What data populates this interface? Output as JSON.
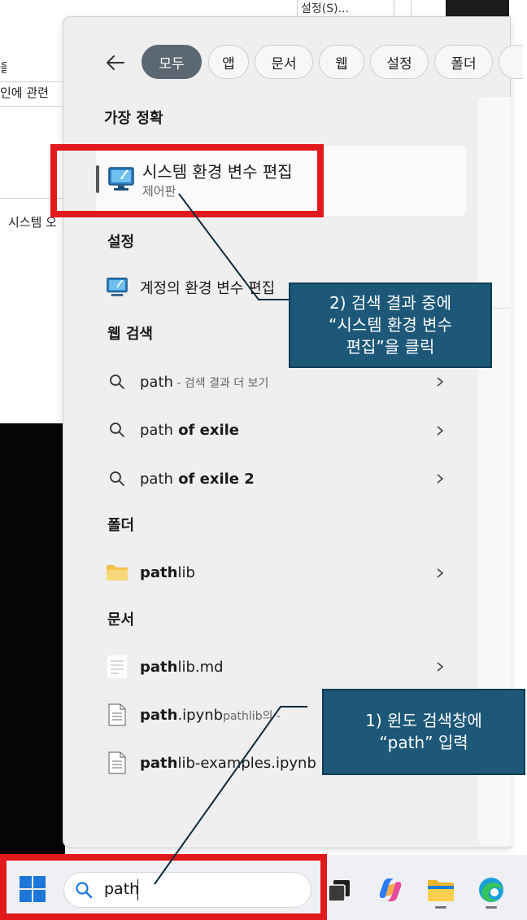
{
  "background": {
    "menu_label": "설정(S)...",
    "line1_text": "인에 관련",
    "line2_text": "시스템 오",
    "left_fragment": "을"
  },
  "search_panel": {
    "filter_chips": [
      "모두",
      "앱",
      "문서",
      "웹",
      "설정",
      "폴더"
    ],
    "best_match": {
      "heading": "가장 정확",
      "title": "시스템 환경 변수 편집",
      "subtitle": "제어판"
    },
    "settings": {
      "heading": "설정",
      "item": "계정의 환경 변수 편집"
    },
    "web_search": {
      "heading": "웹 검색",
      "items": [
        {
          "term": "path",
          "suffix": " - 검색 결과 더 보기",
          "bold_rest": ""
        },
        {
          "term": "path",
          "suffix": "",
          "bold_rest": " of exile"
        },
        {
          "term": "path",
          "suffix": "",
          "bold_rest": " of exile 2"
        }
      ]
    },
    "folders": {
      "heading": "폴더",
      "items": [
        {
          "bold": "path",
          "rest": "lib"
        }
      ]
    },
    "documents": {
      "heading": "문서",
      "items": [
        {
          "bold": "path",
          "rest": "lib.md",
          "context": ""
        },
        {
          "bold": "path",
          "rest": ".ipynb",
          "context": "pathlib의 -"
        },
        {
          "bold": "path",
          "rest": "lib-examples.ipynb",
          "context": ""
        }
      ]
    }
  },
  "taskbar": {
    "search_value": "path",
    "apps": [
      "task-view-icon",
      "copilot-icon",
      "file-explorer-icon",
      "edge-icon"
    ]
  },
  "annotations": {
    "step1": "1) 윈도 검색창에\n“path” 입력",
    "step2": "2) 검색 결과 중에\n“시스템 환경 변수\n편집”을 클릭"
  },
  "colors": {
    "accent": "#1d76d8",
    "active_chip": "#5b6873",
    "highlight_red": "#e1181c",
    "callout_bg": "#1d5878"
  }
}
